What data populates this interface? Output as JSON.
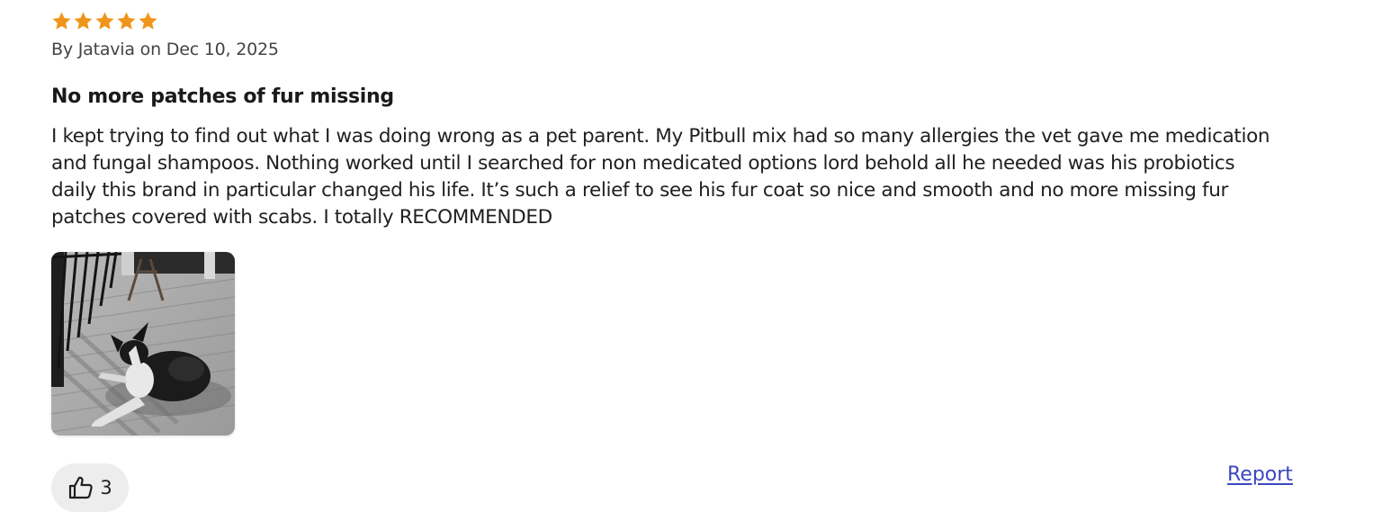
{
  "review": {
    "rating": 5,
    "rating_max": 5,
    "star_color": "#f0951b",
    "byline": "By Jatavia on Dec 10, 2025",
    "title": "No more patches of fur missing",
    "body": "I kept trying to find out what I was doing wrong as a pet parent. My Pitbull mix had so many allergies the vet gave me medication and fungal shampoos. Nothing worked until I searched for non medicated options lord behold all he needed was his probiotics daily this brand in particular changed his life. It’s such a relief to see his fur coat so nice and smooth and no more missing fur patches covered with scabs. I totally RECOMMENDED",
    "photo_icon": "dog-photo",
    "helpful_icon": "thumbs-up-icon",
    "helpful_count": "3",
    "report_label": "Report",
    "link_color": "#3b47bf"
  }
}
